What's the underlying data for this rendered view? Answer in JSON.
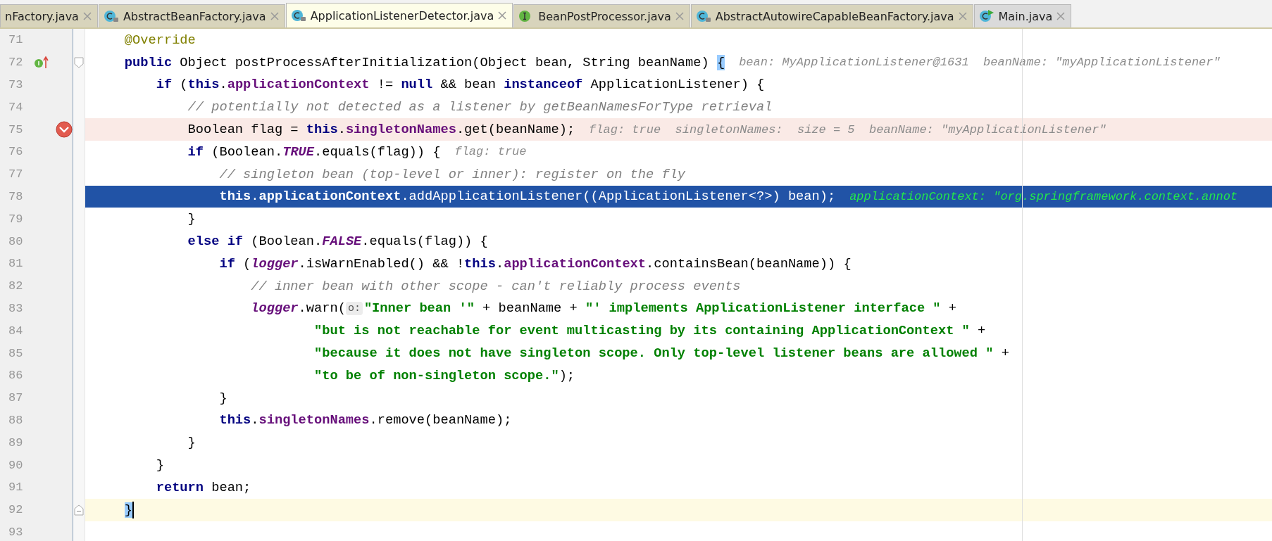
{
  "tabs": [
    {
      "label": "nFactory.java",
      "kind": "cut",
      "selected": false,
      "color": "#d8d4bc"
    },
    {
      "label": "AbstractBeanFactory.java",
      "kind": "library-class",
      "selected": false,
      "color": "#d8d4bc"
    },
    {
      "label": "ApplicationListenerDetector.java",
      "kind": "library-class",
      "selected": true,
      "color": "#fdfde8"
    },
    {
      "label": "BeanPostProcessor.java",
      "kind": "interface",
      "selected": false,
      "color": "#d8d4bc"
    },
    {
      "label": "AbstractAutowireCapableBeanFactory.java",
      "kind": "library-class",
      "selected": false,
      "color": "#d8d4bc"
    },
    {
      "label": "Main.java",
      "kind": "main-class",
      "selected": false,
      "color": "#dadada"
    }
  ],
  "editor": {
    "lines": [
      {
        "number": "71",
        "kind": "plain",
        "segments": [
          {
            "kind": "code",
            "tokens": [
              {
                "kind": "annotation",
                "text": "    @Override"
              }
            ]
          }
        ]
      },
      {
        "number": "72",
        "kind": "plain",
        "implements": true,
        "fold_start": true,
        "segments": [
          {
            "kind": "code",
            "tokens": [
              {
                "kind": "keyword",
                "text": "    public"
              },
              {
                "kind": "plain",
                "text": " Object postProcessAfterInitialization(Object bean, String beanName) "
              },
              {
                "kind": "brace-match",
                "text": "{"
              }
            ]
          },
          {
            "kind": "inlay",
            "text": "bean: MyApplicationListener@1631  beanName: \"myApplicationListener\""
          }
        ]
      },
      {
        "number": "73",
        "kind": "plain",
        "segments": [
          {
            "kind": "code",
            "tokens": [
              {
                "kind": "keyword",
                "text": "        if"
              },
              {
                "kind": "plain",
                "text": " ("
              },
              {
                "kind": "keyword",
                "text": "this"
              },
              {
                "kind": "plain",
                "text": "."
              },
              {
                "kind": "field",
                "text": "applicationContext"
              },
              {
                "kind": "plain",
                "text": " != "
              },
              {
                "kind": "keyword",
                "text": "null"
              },
              {
                "kind": "plain",
                "text": " && bean "
              },
              {
                "kind": "keyword",
                "text": "instanceof"
              },
              {
                "kind": "plain",
                "text": " ApplicationListener) {"
              }
            ]
          }
        ]
      },
      {
        "number": "74",
        "kind": "plain",
        "segments": [
          {
            "kind": "code",
            "tokens": [
              {
                "kind": "comment",
                "text": "            // potentially not detected as a listener by getBeanNamesForType retrieval"
              }
            ]
          }
        ]
      },
      {
        "number": "75",
        "kind": "breakpoint",
        "segments": [
          {
            "kind": "code",
            "tokens": [
              {
                "kind": "plain",
                "text": "            Boolean flag = "
              },
              {
                "kind": "keyword",
                "text": "this"
              },
              {
                "kind": "plain",
                "text": "."
              },
              {
                "kind": "field",
                "text": "singletonNames"
              },
              {
                "kind": "plain",
                "text": ".get(beanName);"
              }
            ]
          },
          {
            "kind": "inlay",
            "text": "flag: true  singletonNames:  size = 5  beanName: \"myApplicationListener\""
          }
        ]
      },
      {
        "number": "76",
        "kind": "plain",
        "segments": [
          {
            "kind": "code",
            "tokens": [
              {
                "kind": "keyword",
                "text": "            if"
              },
              {
                "kind": "plain",
                "text": " (Boolean."
              },
              {
                "kind": "static",
                "text": "TRUE"
              },
              {
                "kind": "plain",
                "text": ".equals(flag)) {"
              }
            ]
          },
          {
            "kind": "inlay",
            "text": "flag: true"
          }
        ]
      },
      {
        "number": "77",
        "kind": "plain",
        "segments": [
          {
            "kind": "code",
            "tokens": [
              {
                "kind": "comment",
                "text": "                // singleton bean (top-level or inner): register on the fly"
              }
            ]
          }
        ]
      },
      {
        "number": "78",
        "kind": "execution",
        "segments": [
          {
            "kind": "code",
            "tokens": [
              {
                "kind": "keyword",
                "text": "                this"
              },
              {
                "kind": "plain",
                "text": "."
              },
              {
                "kind": "field",
                "text": "applicationContext"
              },
              {
                "kind": "plain",
                "text": ".addApplicationListener((ApplicationListener<?>) bean);"
              }
            ]
          },
          {
            "kind": "inlay",
            "text": "applicationContext: \"org.springframework.context.annot"
          }
        ]
      },
      {
        "number": "79",
        "kind": "plain",
        "segments": [
          {
            "kind": "code",
            "tokens": [
              {
                "kind": "plain",
                "text": "            }"
              }
            ]
          }
        ]
      },
      {
        "number": "80",
        "kind": "plain",
        "segments": [
          {
            "kind": "code",
            "tokens": [
              {
                "kind": "keyword",
                "text": "            else if"
              },
              {
                "kind": "plain",
                "text": " (Boolean."
              },
              {
                "kind": "static",
                "text": "FALSE"
              },
              {
                "kind": "plain",
                "text": ".equals(flag)) {"
              }
            ]
          }
        ]
      },
      {
        "number": "81",
        "kind": "plain",
        "segments": [
          {
            "kind": "code",
            "tokens": [
              {
                "kind": "keyword",
                "text": "                if"
              },
              {
                "kind": "plain",
                "text": " ("
              },
              {
                "kind": "static",
                "text": "logger"
              },
              {
                "kind": "plain",
                "text": ".isWarnEnabled() && !"
              },
              {
                "kind": "keyword",
                "text": "this"
              },
              {
                "kind": "plain",
                "text": "."
              },
              {
                "kind": "field",
                "text": "applicationContext"
              },
              {
                "kind": "plain",
                "text": ".containsBean(beanName)) {"
              }
            ]
          }
        ]
      },
      {
        "number": "82",
        "kind": "plain",
        "segments": [
          {
            "kind": "code",
            "tokens": [
              {
                "kind": "comment",
                "text": "                    // inner bean with other scope - can't reliably process events"
              }
            ]
          }
        ]
      },
      {
        "number": "83",
        "kind": "plain",
        "segments": [
          {
            "kind": "code",
            "tokens": [
              {
                "kind": "static",
                "text": "                    logger"
              },
              {
                "kind": "plain",
                "text": ".warn("
              }
            ]
          },
          {
            "kind": "hint",
            "text": "o:"
          },
          {
            "kind": "code",
            "tokens": [
              {
                "kind": "string",
                "text": "\"Inner bean '\""
              },
              {
                "kind": "plain",
                "text": " + beanName + "
              },
              {
                "kind": "string",
                "text": "\"' implements ApplicationListener interface \""
              },
              {
                "kind": "plain",
                "text": " +"
              }
            ]
          }
        ]
      },
      {
        "number": "84",
        "kind": "plain",
        "segments": [
          {
            "kind": "code",
            "tokens": [
              {
                "kind": "string",
                "text": "                            \"but is not reachable for event multicasting by its containing ApplicationContext \""
              },
              {
                "kind": "plain",
                "text": " +"
              }
            ]
          }
        ]
      },
      {
        "number": "85",
        "kind": "plain",
        "segments": [
          {
            "kind": "code",
            "tokens": [
              {
                "kind": "string",
                "text": "                            \"because it does not have singleton scope. Only top-level listener beans are allowed \""
              },
              {
                "kind": "plain",
                "text": " +"
              }
            ]
          }
        ]
      },
      {
        "number": "86",
        "kind": "plain",
        "segments": [
          {
            "kind": "code",
            "tokens": [
              {
                "kind": "string",
                "text": "                            \"to be of non-singleton scope.\""
              },
              {
                "kind": "plain",
                "text": ");"
              }
            ]
          }
        ]
      },
      {
        "number": "87",
        "kind": "plain",
        "segments": [
          {
            "kind": "code",
            "tokens": [
              {
                "kind": "plain",
                "text": "                }"
              }
            ]
          }
        ]
      },
      {
        "number": "88",
        "kind": "plain",
        "segments": [
          {
            "kind": "code",
            "tokens": [
              {
                "kind": "keyword",
                "text": "                this"
              },
              {
                "kind": "plain",
                "text": "."
              },
              {
                "kind": "field",
                "text": "singletonNames"
              },
              {
                "kind": "plain",
                "text": ".remove(beanName);"
              }
            ]
          }
        ]
      },
      {
        "number": "89",
        "kind": "plain",
        "segments": [
          {
            "kind": "code",
            "tokens": [
              {
                "kind": "plain",
                "text": "            }"
              }
            ]
          }
        ]
      },
      {
        "number": "90",
        "kind": "plain",
        "segments": [
          {
            "kind": "code",
            "tokens": [
              {
                "kind": "plain",
                "text": "        }"
              }
            ]
          }
        ]
      },
      {
        "number": "91",
        "kind": "plain",
        "segments": [
          {
            "kind": "code",
            "tokens": [
              {
                "kind": "keyword",
                "text": "        return"
              },
              {
                "kind": "plain",
                "text": " bean;"
              }
            ]
          }
        ]
      },
      {
        "number": "92",
        "kind": "caret",
        "fold_end": true,
        "segments": [
          {
            "kind": "code",
            "tokens": [
              {
                "kind": "brace-match",
                "text": "    }"
              }
            ]
          }
        ]
      },
      {
        "number": "93",
        "kind": "plain"
      }
    ]
  }
}
